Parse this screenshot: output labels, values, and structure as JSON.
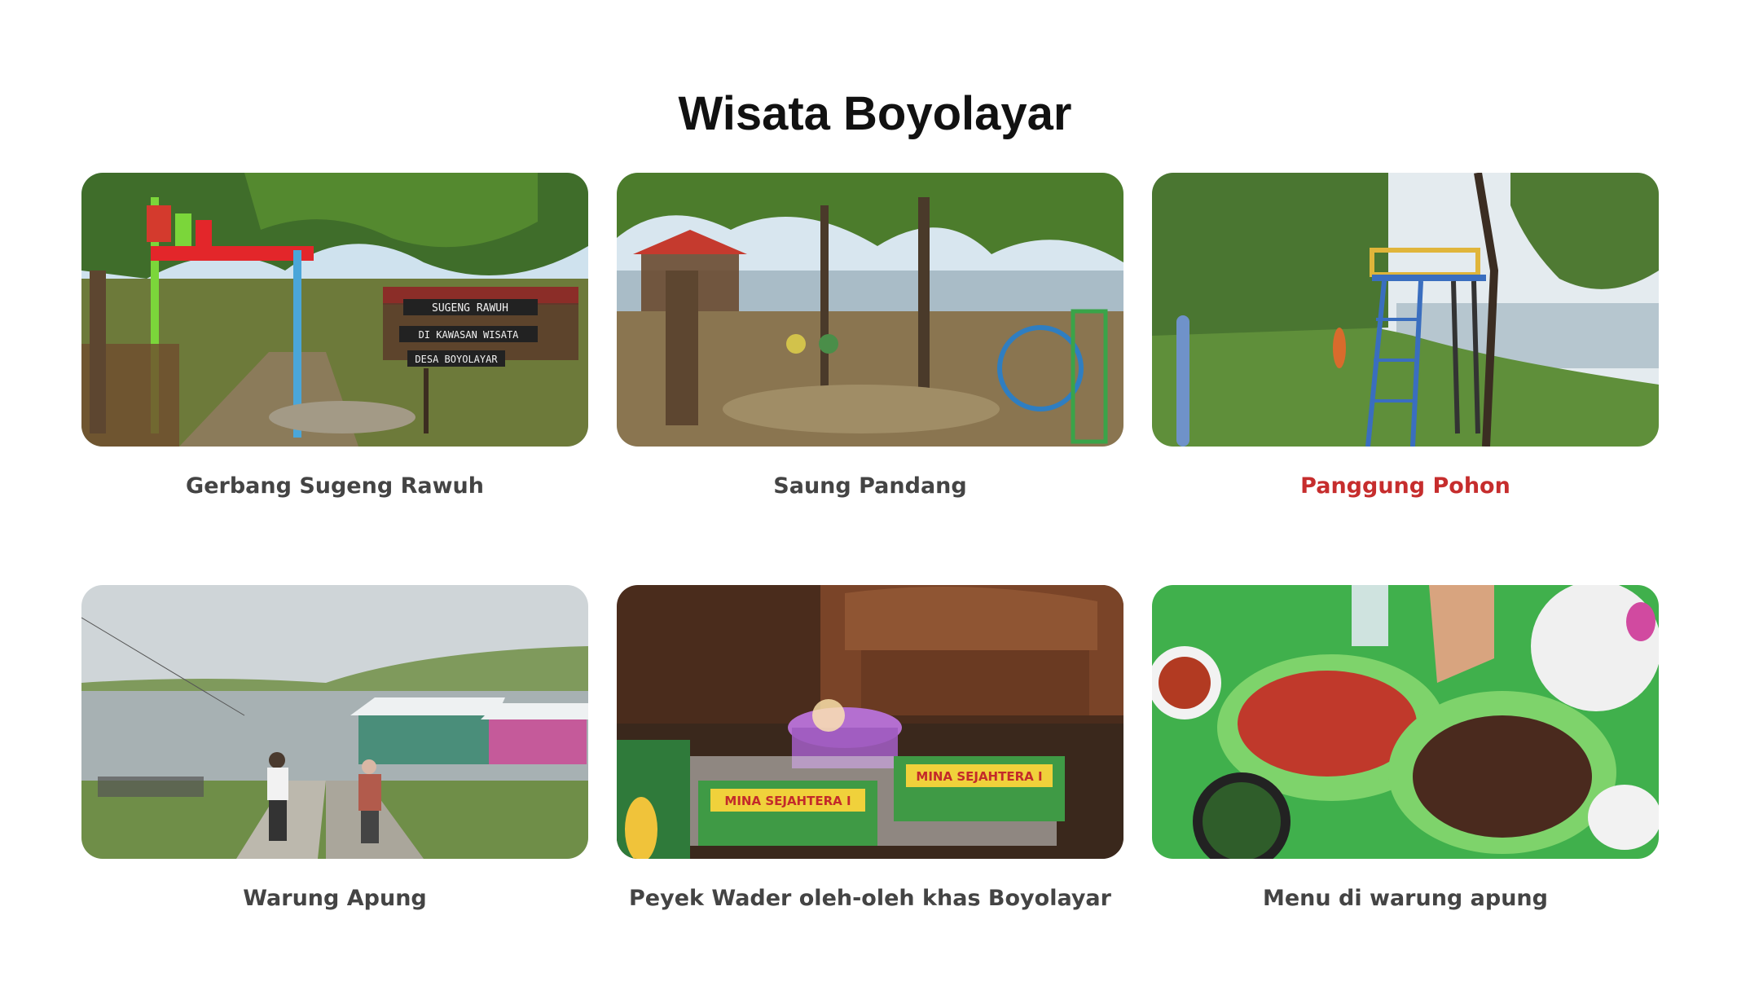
{
  "section": {
    "title": "Wisata Boyolayar"
  },
  "gallery": {
    "items": [
      {
        "caption": "Gerbang Sugeng Rawuh",
        "sign_lines": [
          "SUGENG RAWUH",
          "DI KAWASAN WISATA",
          "DESA BOYOLAYAR"
        ]
      },
      {
        "caption": "Saung Pandang"
      },
      {
        "caption": "Panggung Pohon",
        "active": true
      },
      {
        "caption": "Warung Apung"
      },
      {
        "caption": "Peyek Wader oleh-oleh khas Boyolayar",
        "label_lines": [
          "MINA SEJAHTERA I",
          "MINA SEJAHTERA I"
        ]
      },
      {
        "caption": "Menu di warung apung"
      }
    ]
  },
  "colors": {
    "active_caption": "#c62d2d",
    "caption": "#444444",
    "title": "#111111"
  }
}
